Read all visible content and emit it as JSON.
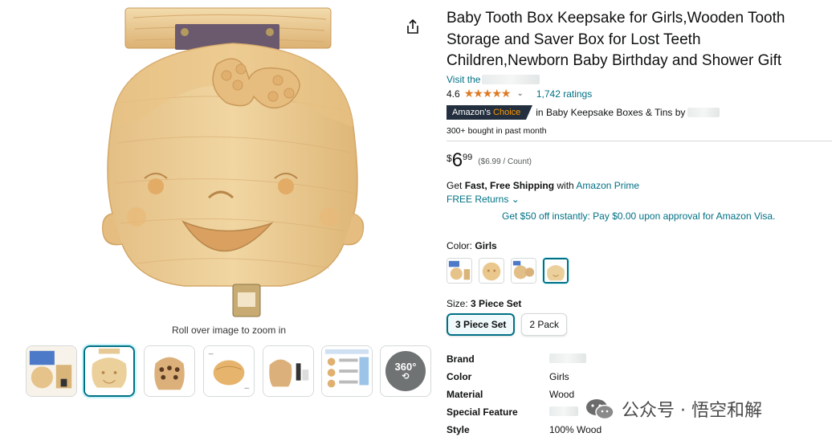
{
  "product": {
    "title": "Baby Tooth Box Keepsake for Girls,Wooden Tooth Storage and Saver Box for Lost Teeth Children,Newborn Baby Birthday and Shower Gift",
    "store_link": "Visit the",
    "rating": "4.6",
    "stars": "★★★★★",
    "ratings_count": "1,742 ratings",
    "choice_prefix": "Amazon's",
    "choice_word": "Choice",
    "choice_text": "in Baby Keepsake Boxes & Tins by",
    "bought": "300+ bought in past month"
  },
  "gallery": {
    "zoom_hint": "Roll over image to zoom in",
    "badge_360": "360°",
    "selected_index": 1
  },
  "price": {
    "symbol": "$",
    "whole": "6",
    "fraction": "99",
    "unit": "($6.99 / Count)"
  },
  "shipping": {
    "prefix": "Get",
    "bold": "Fast, Free Shipping",
    "with": "with",
    "prime": "Amazon Prime",
    "returns": "FREE Returns",
    "returns_chevron": "⌄",
    "promo": "Get $50 off instantly: Pay $0.00 upon approval for Amazon Visa."
  },
  "color": {
    "label": "Color:",
    "value": "Girls"
  },
  "size": {
    "label": "Size:",
    "value": "3 Piece Set",
    "options": [
      "3 Piece Set",
      "2 Pack"
    ]
  },
  "specs": [
    {
      "key": "Brand",
      "value": ""
    },
    {
      "key": "Color",
      "value": "Girls"
    },
    {
      "key": "Material",
      "value": "Wood"
    },
    {
      "key": "Special Feature",
      "value": ""
    },
    {
      "key": "Style",
      "value": "100% Wood"
    }
  ],
  "watermark": {
    "text": "公众号 · 悟空和解"
  },
  "colors": {
    "link": "#007185",
    "star": "#de7921",
    "badge_bg": "#232f3e",
    "badge_accent": "#ff9900",
    "wood": "#e9c98e"
  },
  "icons": {
    "share": "share-icon",
    "chevron": "chevron-down-icon",
    "rotate": "rotate-360-icon"
  }
}
